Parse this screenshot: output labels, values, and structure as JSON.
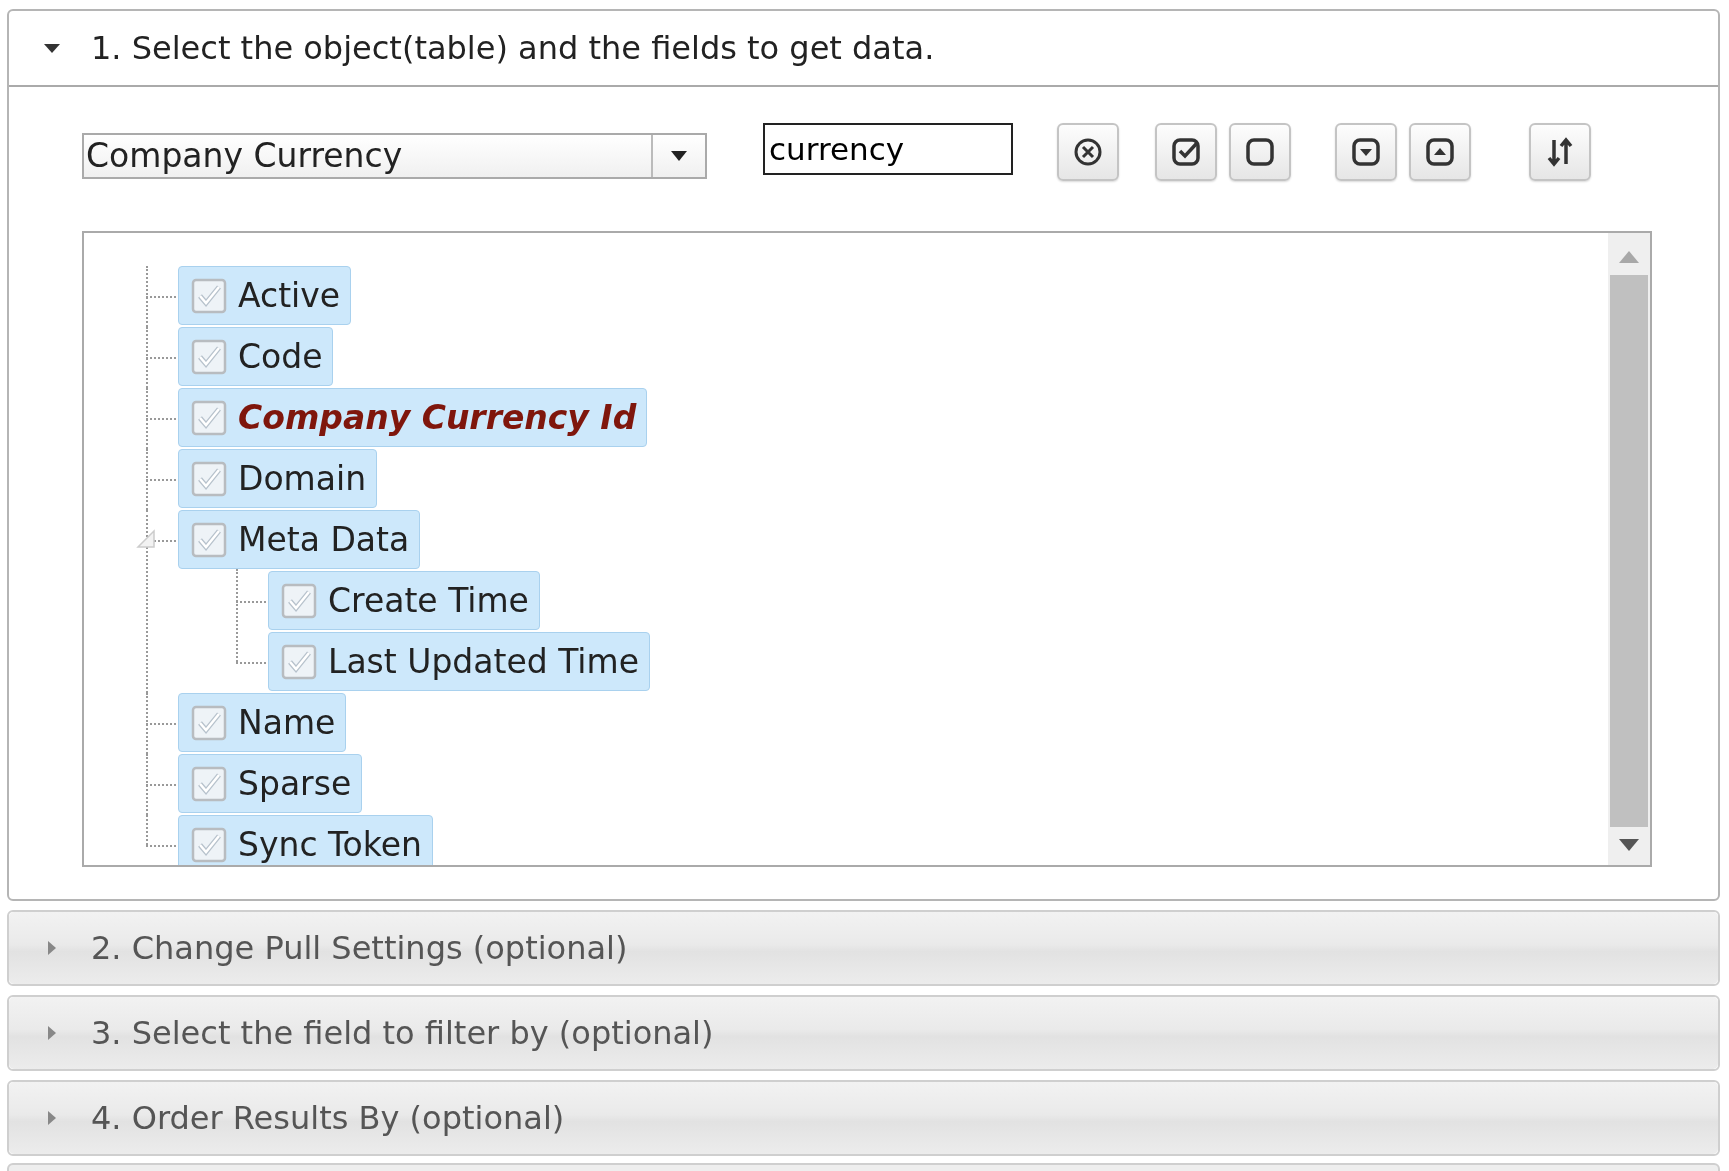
{
  "sections": [
    {
      "title": "1. Select the object(table) and the fields to get data.",
      "expanded": true,
      "object_select": {
        "value": "Company Currency"
      },
      "search": {
        "value": "currency"
      },
      "toolbar_groups": [
        {
          "buttons": [
            {
              "kind": "clear"
            }
          ]
        },
        {
          "buttons": [
            {
              "kind": "check_all"
            },
            {
              "kind": "uncheck_all"
            }
          ]
        },
        {
          "buttons": [
            {
              "kind": "expand_all"
            },
            {
              "kind": "collapse_all"
            }
          ]
        },
        {
          "buttons": [
            {
              "kind": "sort"
            }
          ]
        }
      ],
      "fields": [
        {
          "label": "Active",
          "checked": true,
          "key": false
        },
        {
          "label": "Code",
          "checked": true,
          "key": false
        },
        {
          "label": "Company Currency Id",
          "checked": true,
          "key": true
        },
        {
          "label": "Domain",
          "checked": true,
          "key": false
        },
        {
          "label": "Meta Data",
          "checked": true,
          "key": false,
          "expanded": true,
          "children": [
            {
              "label": "Create Time",
              "checked": true,
              "key": false
            },
            {
              "label": "Last Updated Time",
              "checked": true,
              "key": false
            }
          ]
        },
        {
          "label": "Name",
          "checked": true,
          "key": false
        },
        {
          "label": "Sparse",
          "checked": true,
          "key": false
        },
        {
          "label": "Sync Token",
          "checked": true,
          "key": false
        }
      ]
    },
    {
      "title": "2. Change Pull Settings (optional)",
      "expanded": false
    },
    {
      "title": "3. Select the field to filter by (optional)",
      "expanded": false
    },
    {
      "title": "4. Order Results By (optional)",
      "expanded": false
    }
  ]
}
